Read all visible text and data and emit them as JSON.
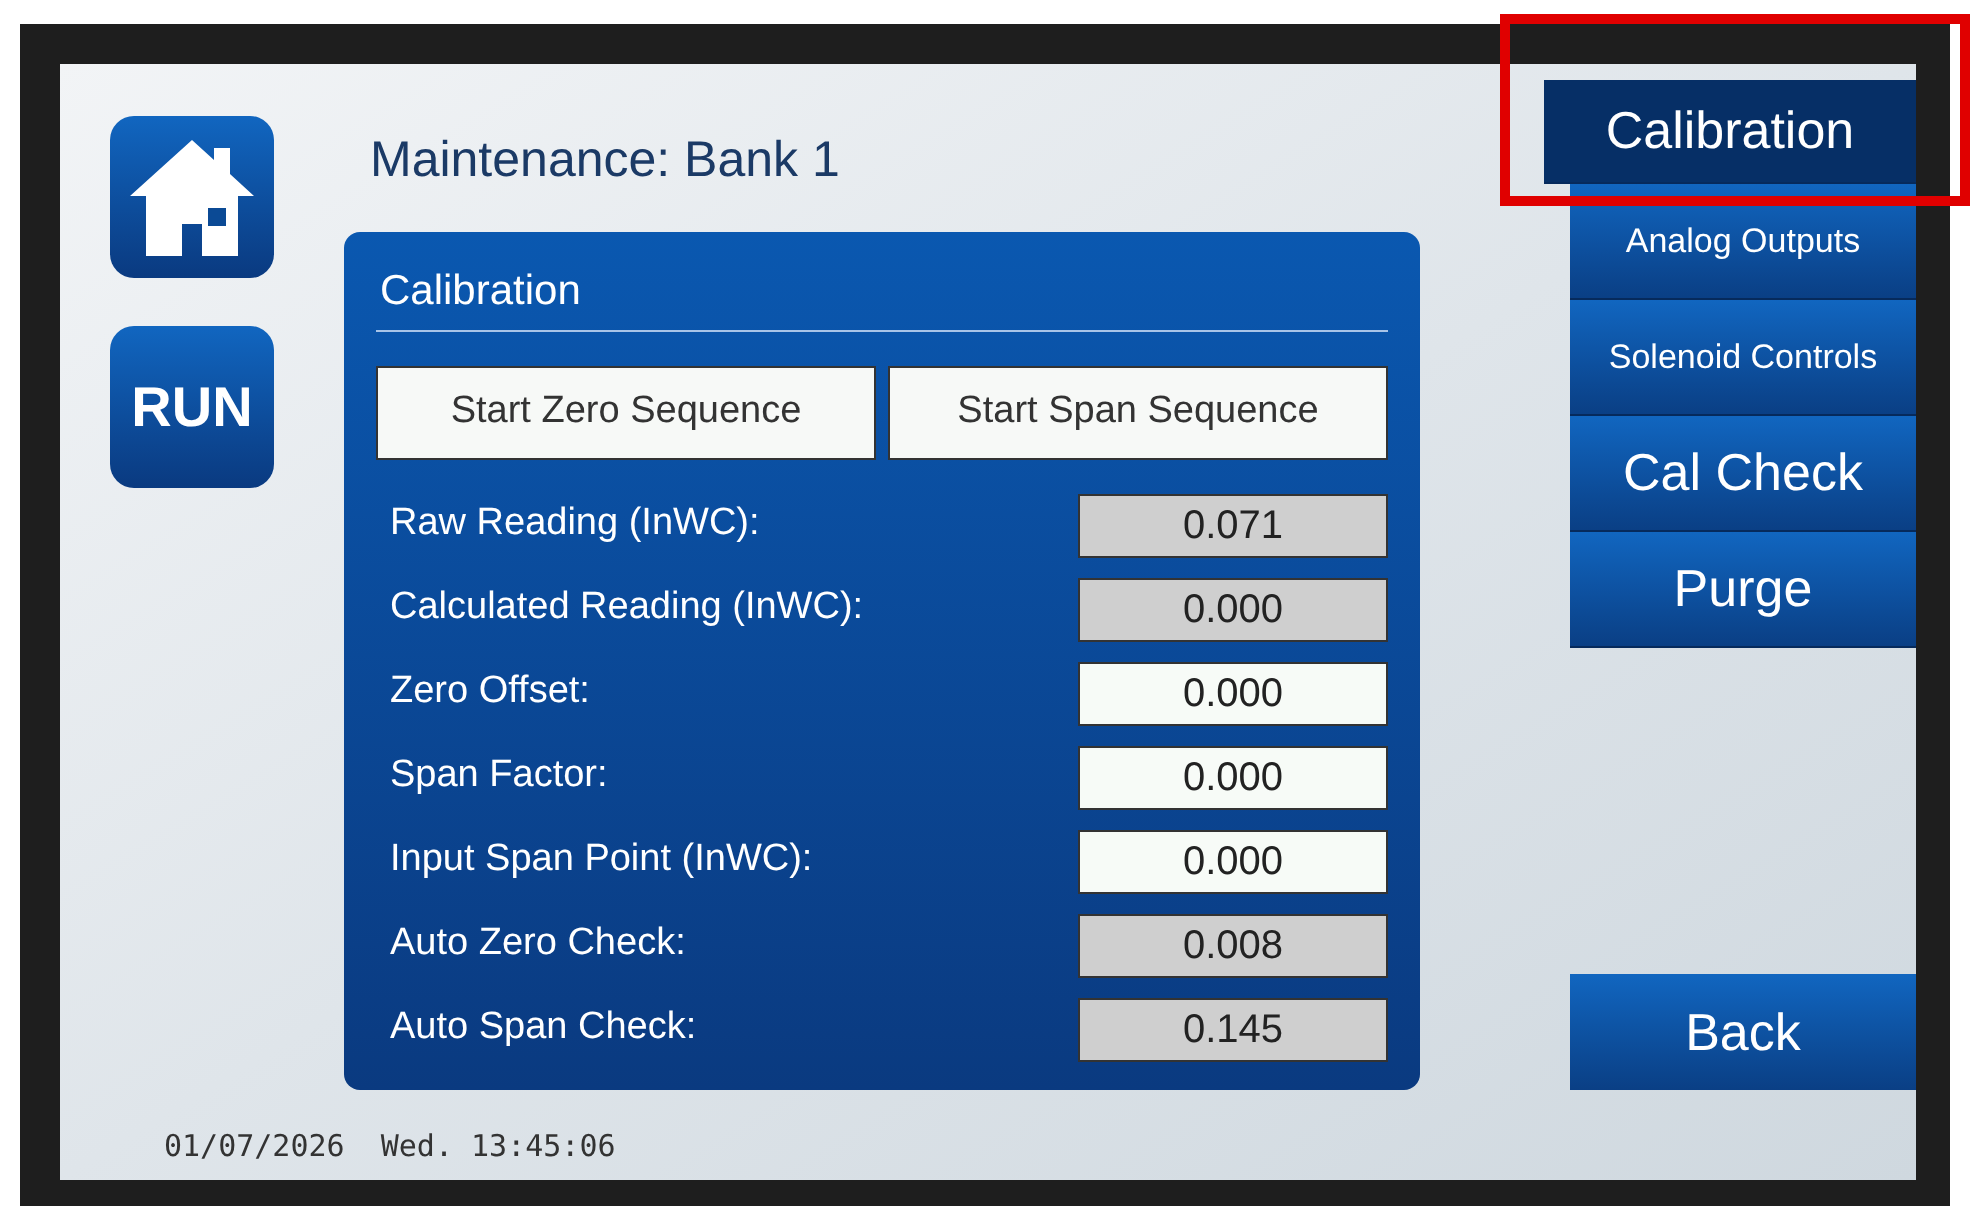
{
  "title": "Maintenance: Bank 1",
  "left_buttons": [
    {
      "kind": "home"
    },
    {
      "kind": "text",
      "label": "RUN"
    }
  ],
  "panel": {
    "title": "Calibration",
    "actions": [
      "Start Zero Sequence",
      "Start Span Sequence"
    ],
    "fields": [
      {
        "label": "Raw Reading (InWC):",
        "value": "0.071",
        "editable": false
      },
      {
        "label": "Calculated Reading (InWC):",
        "value": "0.000",
        "editable": false
      },
      {
        "label": "Zero Offset:",
        "value": "0.000",
        "editable": true
      },
      {
        "label": "Span Factor:",
        "value": "0.000",
        "editable": true
      },
      {
        "label": "Input Span Point (InWC):",
        "value": "0.000",
        "editable": true
      },
      {
        "label": "Auto Zero Check:",
        "value": "0.008",
        "editable": false
      },
      {
        "label": "Auto Span Check:",
        "value": "0.145",
        "editable": false
      }
    ]
  },
  "nav": [
    {
      "label": "Calibration",
      "selected": true,
      "highlighted": true,
      "kind": "large"
    },
    {
      "label": "Analog Outputs",
      "selected": false,
      "highlighted": false,
      "kind": "small"
    },
    {
      "label": "Solenoid Controls",
      "selected": false,
      "highlighted": false,
      "kind": "small"
    },
    {
      "label": "Cal Check",
      "selected": false,
      "highlighted": false,
      "kind": "large"
    },
    {
      "label": "Purge",
      "selected": false,
      "highlighted": false,
      "kind": "large"
    }
  ],
  "back_button": "Back",
  "status": "01/07/2026  Wed. 13:45:06"
}
